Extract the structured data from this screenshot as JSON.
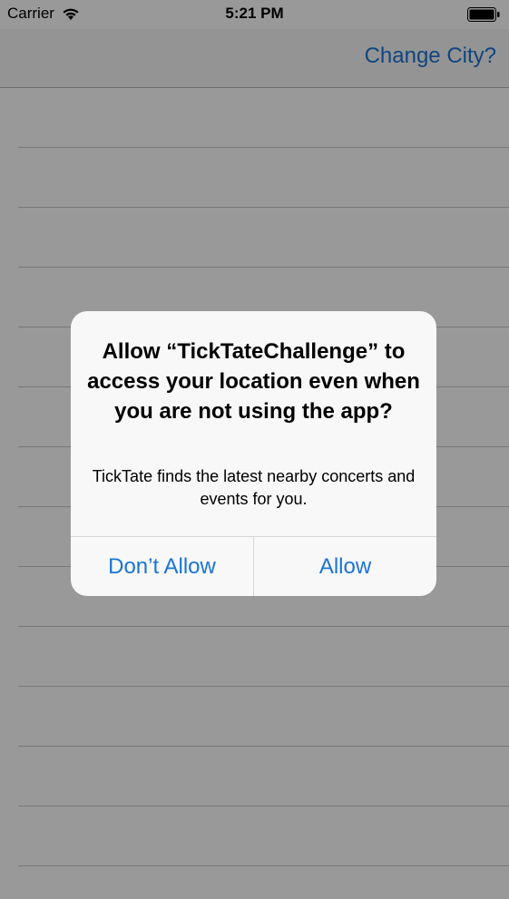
{
  "status_bar": {
    "carrier": "Carrier",
    "time": "5:21 PM",
    "wifi_icon": "wifi-icon",
    "battery_icon": "battery-full-icon"
  },
  "nav_bar": {
    "right_button": "Change City?"
  },
  "colors": {
    "accent": "#1a74d6",
    "alert_background": "#f8f8f8",
    "dim_overlay": "rgba(0,0,0,0.4)"
  },
  "table": {
    "row_count": 14
  },
  "alert": {
    "title": "Allow “TickTateChallenge” to access your location even when you are not using the app?",
    "message": "TickTate finds the latest nearby concerts and events for you.",
    "buttons": [
      {
        "label": "Don’t Allow"
      },
      {
        "label": "Allow"
      }
    ]
  }
}
